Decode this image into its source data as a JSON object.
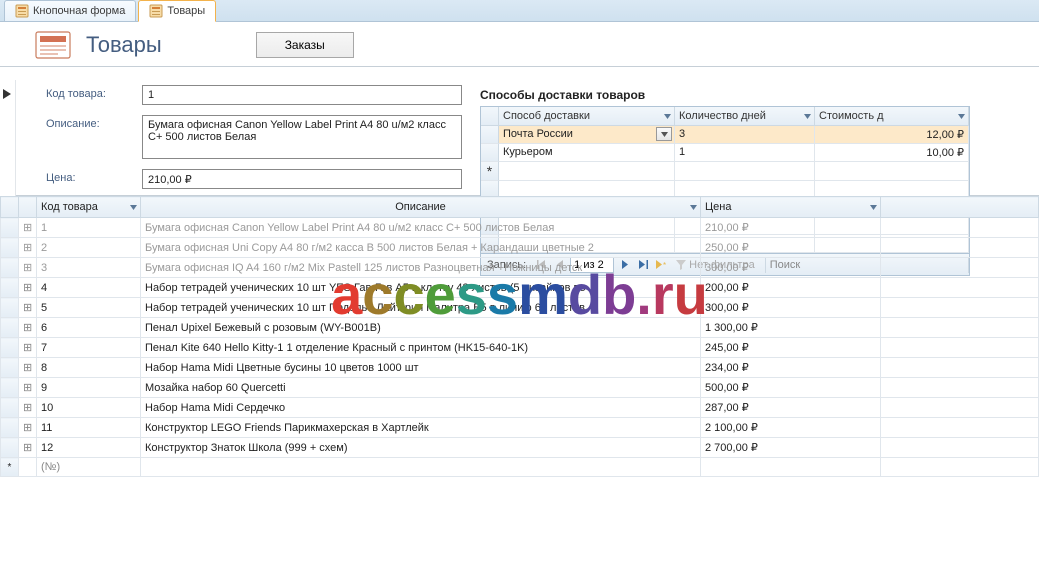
{
  "tabs": [
    {
      "label": "Кнопочная форма",
      "active": false
    },
    {
      "label": "Товары",
      "active": true
    }
  ],
  "header": {
    "title": "Товары"
  },
  "orders_btn": "Заказы",
  "fields": {
    "code_label": "Код товара:",
    "code_value": "1",
    "desc_label": "Описание:",
    "desc_value": "Бумага офисная Canon Yellow Label Print A4 80 u/м2 класс C+ 500 листов Белая",
    "price_label": "Цена:",
    "price_value": "210,00 ₽"
  },
  "subform": {
    "title": "Способы доставки товаров",
    "columns": [
      "Способ доставки",
      "Количество дней",
      "Стоимость д"
    ],
    "rows": [
      {
        "method": "Почта России",
        "days": "3",
        "cost": "12,00 ₽",
        "selected": true,
        "combo": true
      },
      {
        "method": "Курьером",
        "days": "1",
        "cost": "10,00 ₽"
      }
    ],
    "nav": {
      "label": "Запись:",
      "pos": "1 из 2",
      "nofilter": "Нет фильтра",
      "search": "Поиск"
    }
  },
  "datasheet": {
    "columns": [
      "Код товара",
      "Описание",
      "Цена"
    ],
    "rows": [
      {
        "id": "1",
        "desc": "Бумага офисная Canon Yellow Label Print A4 80 u/м2 класс C+ 500 листов Белая",
        "price": "210,00 ₽",
        "dim": true
      },
      {
        "id": "2",
        "desc": "Бумага офисная Uni Copy A4 80 г/м2 касса В 500 листов Белая + Карандаши цветные 2",
        "price": "250,00 ₽",
        "dim": true
      },
      {
        "id": "3",
        "desc": "Бумага офисная IQ A4 160 г/м2 Mix Pastell 125 листов Разноцветная  +Ножницы детск",
        "price": "300,00 ₽",
        "dim": true
      },
      {
        "id": "4",
        "desc": "Набор тетрадей ученических 10 шт YES Гав-Гав А5 в клетку 48 листов (5 дизайнов по",
        "price": "200,00 ₽"
      },
      {
        "id": "5",
        "desc": "Набор тетрадей ученических 10 шт Подолье Лайтгрин Палитра В5 в линию 60 листов",
        "price": "300,00 ₽"
      },
      {
        "id": "6",
        "desc": "Пенал Upixel Бежевый с розовым (WY-B001B)",
        "price": "1 300,00 ₽"
      },
      {
        "id": "7",
        "desc": "Пенал Kite 640 Hello Kitty-1 1 отделение Красный с принтом (HK15-640-1K)",
        "price": "245,00 ₽"
      },
      {
        "id": "8",
        "desc": "Набор Hama Midi Цветные бусины 10 цветов 1000 шт",
        "price": "234,00 ₽"
      },
      {
        "id": "9",
        "desc": "Мозайка набор 60 Quercetti",
        "price": "500,00 ₽"
      },
      {
        "id": "10",
        "desc": "Набор Hama Midi Сердечко",
        "price": "287,00 ₽"
      },
      {
        "id": "11",
        "desc": "Конструктор LEGO Friends Парикмахерская в Хартлейк",
        "price": "2 100,00 ₽"
      },
      {
        "id": "12",
        "desc": "Конструктор Знаток Школа (999 + схем)",
        "price": "2 700,00 ₽"
      }
    ],
    "new_id": "(№)"
  },
  "watermark": "accessmdb.ru"
}
